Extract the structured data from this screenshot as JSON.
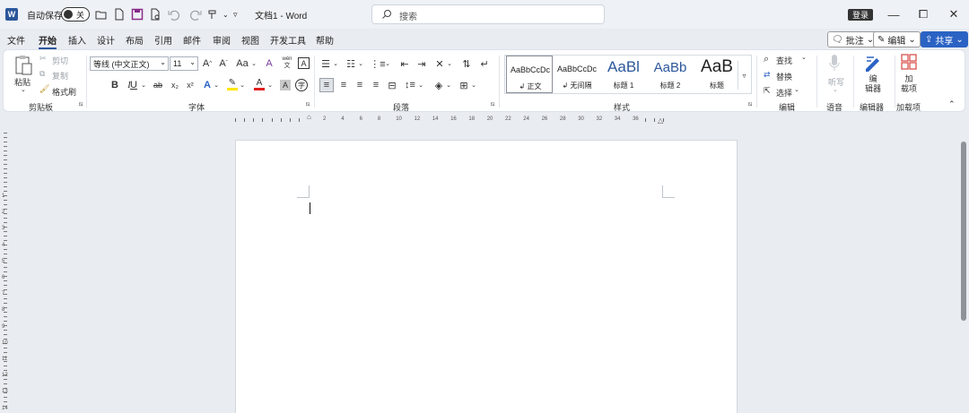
{
  "titlebar": {
    "logo_letter": "W",
    "autosave_label": "自动保存",
    "autosave_state": "关",
    "doc_title": "文档1 - Word",
    "search_placeholder": "搜索",
    "login_label": "登录",
    "minimize": "—",
    "maximize": "⧠",
    "close": "✕"
  },
  "menu": {
    "tabs": [
      "文件",
      "开始",
      "插入",
      "设计",
      "布局",
      "引用",
      "邮件",
      "审阅",
      "视图",
      "开发工具",
      "帮助"
    ],
    "comments_label": "批注",
    "editing_label": "编辑",
    "share_label": "共享"
  },
  "clipboard": {
    "paste_label": "粘贴",
    "cut_label": "剪切",
    "copy_label": "复制",
    "format_painter_label": "格式刷",
    "group_label": "剪贴板"
  },
  "font": {
    "font_name": "等线 (中文正文)",
    "font_size": "11",
    "group_label": "字体",
    "bold": "B",
    "italic": "I",
    "underline": "U",
    "strikethrough": "ab",
    "subscript": "x₂",
    "superscript": "x²",
    "grow": "A^",
    "shrink": "A˅",
    "change_case": "Aa",
    "pinyin": "wén",
    "char_border": "A"
  },
  "paragraph": {
    "group_label": "段落"
  },
  "styles": {
    "group_label": "样式",
    "items": [
      {
        "preview": "AaBbCcDc",
        "name": "↲ 正文"
      },
      {
        "preview": "AaBbCcDc",
        "name": "↲ 无间隔"
      },
      {
        "preview": "AaBl",
        "name": "标题 1"
      },
      {
        "preview": "AaBb",
        "name": "标题 2"
      },
      {
        "preview": "AaB",
        "name": "标题"
      }
    ]
  },
  "editing": {
    "find_label": "查找",
    "replace_label": "替换",
    "select_label": "选择",
    "group_label": "编辑"
  },
  "voice": {
    "dictate_label": "听写",
    "group_label": "语音"
  },
  "editor": {
    "label": "编\n辑器",
    "group_label": "编辑器"
  },
  "addins": {
    "label": "加\n载项",
    "group_label": "加载项"
  },
  "ruler": {
    "h_numbers": [
      "2",
      "4",
      "6",
      "8",
      "10",
      "12",
      "14",
      "16",
      "18",
      "20",
      "22",
      "24",
      "26",
      "28",
      "30",
      "32",
      "34",
      "36"
    ],
    "v_numbers": [
      "1",
      "2",
      "3",
      "4",
      "5",
      "6",
      "7",
      "8",
      "9",
      "10",
      "11",
      "12",
      "13",
      "14",
      "15",
      "16"
    ]
  },
  "colors": {
    "accent": "#2b579a",
    "share_bg": "#2b63c4",
    "highlight": "#ffe600",
    "font_color": "#e02020"
  }
}
